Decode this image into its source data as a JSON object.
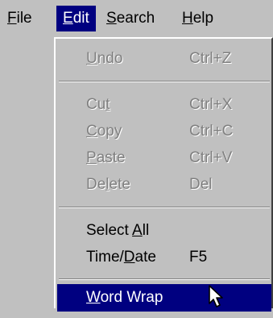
{
  "menubar": {
    "items": [
      {
        "label": "File",
        "accel": "F"
      },
      {
        "label": "Edit",
        "accel": "E"
      },
      {
        "label": "Search",
        "accel": "S"
      },
      {
        "label": "Help",
        "accel": "H"
      }
    ]
  },
  "edit_menu": {
    "undo": {
      "label": "Undo",
      "shortcut": "Ctrl+Z",
      "enabled": false
    },
    "cut": {
      "label": "Cut",
      "shortcut": "Ctrl+X",
      "enabled": false
    },
    "copy": {
      "label": "Copy",
      "shortcut": "Ctrl+C",
      "enabled": false
    },
    "paste": {
      "label": "Paste",
      "shortcut": "Ctrl+V",
      "enabled": false
    },
    "delete": {
      "label": "Delete",
      "shortcut": "Del",
      "enabled": false
    },
    "select_all": {
      "label": "Select All",
      "shortcut": "",
      "enabled": true
    },
    "time_date": {
      "label": "Time/Date",
      "shortcut": "F5",
      "enabled": true
    },
    "word_wrap": {
      "label": "Word Wrap",
      "shortcut": "",
      "enabled": true,
      "highlighted": true
    }
  },
  "colors": {
    "menu_bg": "#c0c0c0",
    "highlight": "#000080",
    "disabled_text": "#808080"
  },
  "icons": {
    "cursor": "mouse-pointer-arrow-icon"
  }
}
